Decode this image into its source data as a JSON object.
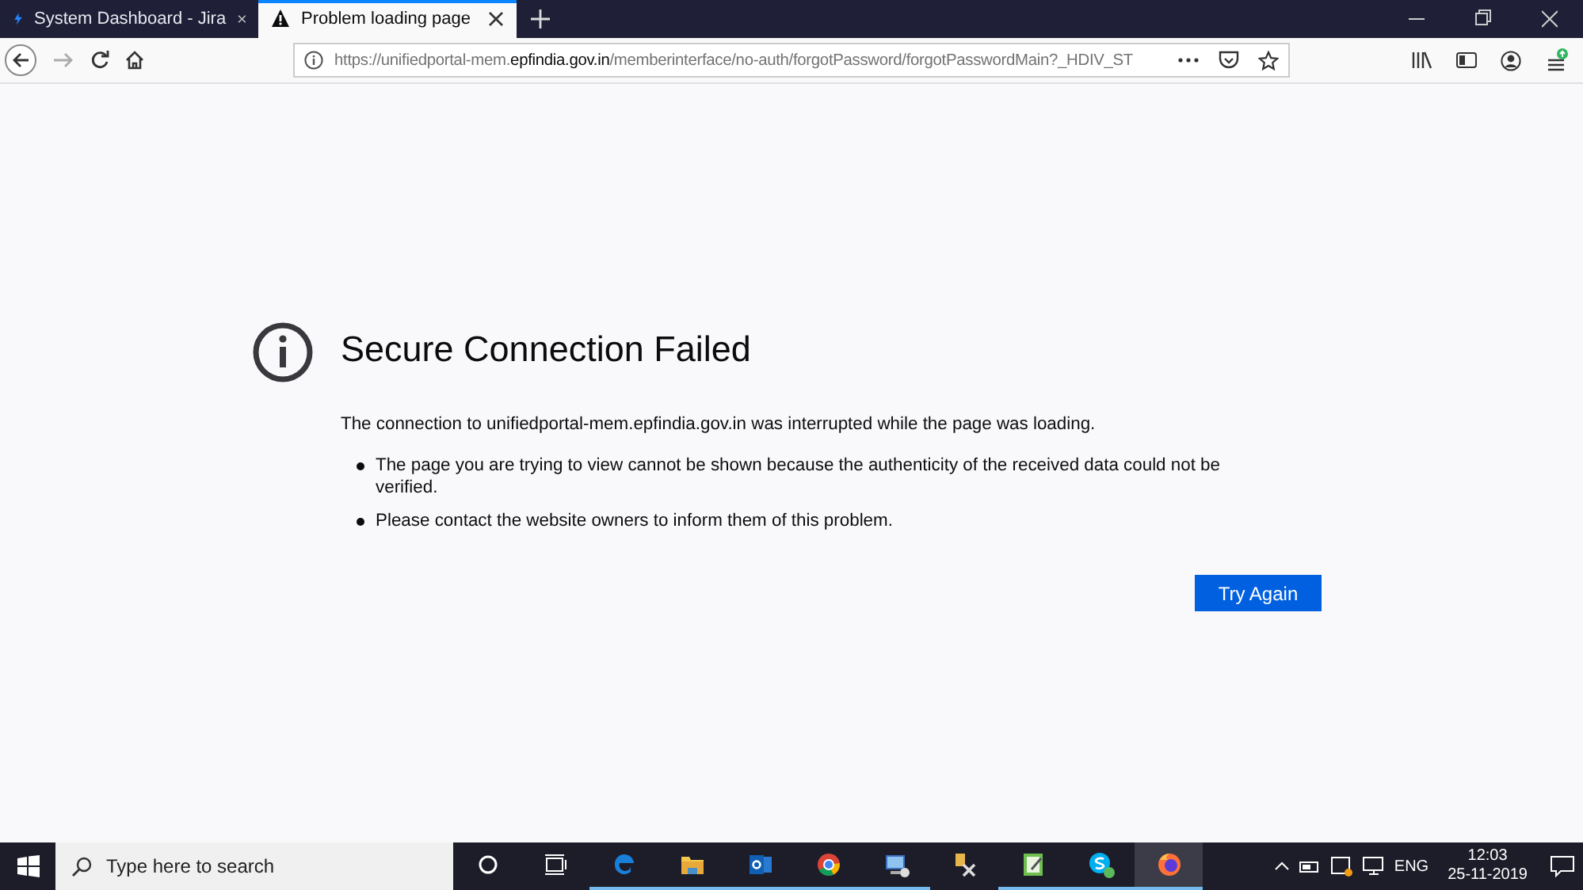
{
  "tabs": [
    {
      "title": "System Dashboard - Jira",
      "kind": "jira",
      "selected": false
    },
    {
      "title": "Problem loading page",
      "kind": "warning",
      "selected": true
    }
  ],
  "address_bar": {
    "url_prefix": "https://unifiedportal-mem.",
    "url_domain": "epfindia.gov.in",
    "url_suffix": "/memberinterface/no-auth/forgotPassword/forgotPasswordMain?_HDIV_ST"
  },
  "error": {
    "title": "Secure Connection Failed",
    "message": "The connection to unifiedportal-mem.epfindia.gov.in was interrupted while the page was loading.",
    "bullets": [
      "The page you are trying to view cannot be shown because the authenticity of the received data could not be verified.",
      "Please contact the website owners to inform them of this problem."
    ],
    "button": "Try Again"
  },
  "taskbar": {
    "search_placeholder": "Type here to search",
    "apps": [
      {
        "kind": "cortana",
        "running": false,
        "selected": false
      },
      {
        "kind": "taskview",
        "running": false,
        "selected": false
      },
      {
        "kind": "edge",
        "running": true,
        "selected": false
      },
      {
        "kind": "explorer",
        "running": true,
        "selected": false
      },
      {
        "kind": "outlook",
        "running": true,
        "selected": false
      },
      {
        "kind": "chrome",
        "running": true,
        "selected": false
      },
      {
        "kind": "remote",
        "running": true,
        "selected": false
      },
      {
        "kind": "tools",
        "running": false,
        "selected": false
      },
      {
        "kind": "notepad",
        "running": true,
        "selected": false
      },
      {
        "kind": "skype",
        "running": true,
        "selected": false
      },
      {
        "kind": "firefox",
        "running": true,
        "selected": true
      }
    ],
    "language": "ENG",
    "time": "12:03",
    "date": "25-11-2019"
  }
}
